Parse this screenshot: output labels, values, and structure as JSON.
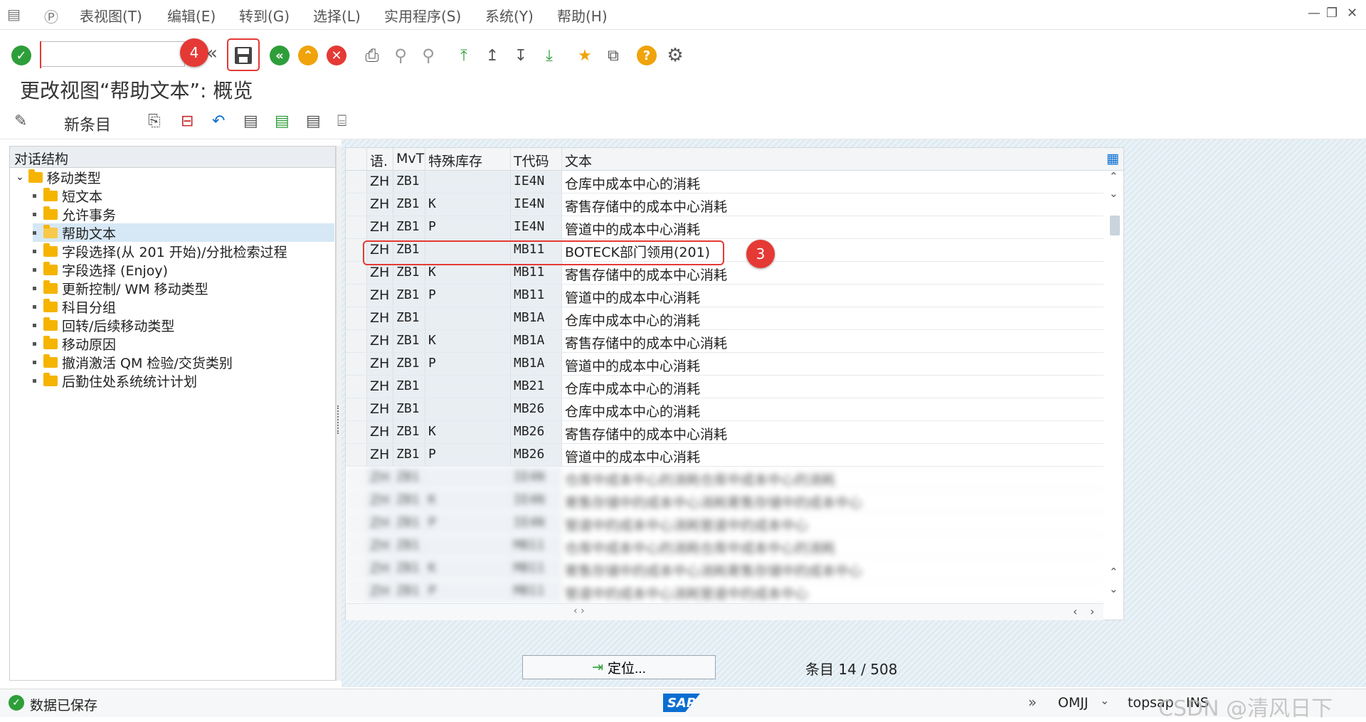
{
  "menu": {
    "items": [
      "表视图(T)",
      "编辑(E)",
      "转到(G)",
      "选择(L)",
      "实用程序(S)",
      "系统(Y)",
      "帮助(H)"
    ],
    "window_controls": [
      "—",
      "❐",
      "✕"
    ]
  },
  "toolbar": {
    "command_field_value": "",
    "markers": {
      "save": "4",
      "row": "3"
    }
  },
  "page": {
    "title": "更改视图“帮助文本”: 概览"
  },
  "app_toolbar": {
    "new_entries": "新条目"
  },
  "tree": {
    "header": "对话结构",
    "root": "移动类型",
    "items": [
      "短文本",
      "允许事务",
      "帮助文本",
      "字段选择(从 201 开始)/分批检索过程",
      "字段选择 (Enjoy)",
      "更新控制/ WM 移动类型",
      "科目分组",
      "回转/后续移动类型",
      "移动原因",
      "撤消激活 QM 检验/交货类别",
      "后勤住处系统统计计划"
    ],
    "selected": "帮助文本"
  },
  "table": {
    "columns": [
      "语.",
      "MvT",
      "特殊库存",
      "T代码",
      "文本"
    ],
    "rows": [
      [
        "ZH",
        "ZB1",
        "",
        "IE4N",
        "仓库中成本中心的消耗"
      ],
      [
        "ZH",
        "ZB1",
        "K",
        "IE4N",
        "寄售存储中的成本中心消耗"
      ],
      [
        "ZH",
        "ZB1",
        "P",
        "IE4N",
        "管道中的成本中心消耗"
      ],
      [
        "ZH",
        "ZB1",
        "",
        "MB11",
        "BOTECK部门领用(201)"
      ],
      [
        "ZH",
        "ZB1",
        "K",
        "MB11",
        "寄售存储中的成本中心消耗"
      ],
      [
        "ZH",
        "ZB1",
        "P",
        "MB11",
        "管道中的成本中心消耗"
      ],
      [
        "ZH",
        "ZB1",
        "",
        "MB1A",
        "仓库中成本中心的消耗"
      ],
      [
        "ZH",
        "ZB1",
        "K",
        "MB1A",
        "寄售存储中的成本中心消耗"
      ],
      [
        "ZH",
        "ZB1",
        "P",
        "MB1A",
        "管道中的成本中心消耗"
      ],
      [
        "ZH",
        "ZB1",
        "",
        "MB21",
        "仓库中成本中心的消耗"
      ],
      [
        "ZH",
        "ZB1",
        "",
        "MB26",
        "仓库中成本中心的消耗"
      ],
      [
        "ZH",
        "ZB1",
        "K",
        "MB26",
        "寄售存储中的成本中心消耗"
      ],
      [
        "ZH",
        "ZB1",
        "P",
        "MB26",
        "管道中的成本中心消耗"
      ]
    ],
    "blurred_rows": [
      [
        "ZH",
        "ZB1",
        "",
        "IE4N",
        "仓库中成本中心的消耗仓库中成本中心的消耗"
      ],
      [
        "ZH",
        "ZB1",
        "K",
        "IE4N",
        "寄售存储中的成本中心消耗寄售存储中的成本中心"
      ],
      [
        "ZH",
        "ZB1",
        "P",
        "IE4N",
        "管道中的成本中心消耗管道中的成本中心"
      ],
      [
        "ZH",
        "ZB1",
        "",
        "MB11",
        "仓库中成本中心的消耗仓库中成本中心的消耗"
      ],
      [
        "ZH",
        "ZB1",
        "K",
        "MB11",
        "寄售存储中的成本中心消耗寄售存储中的成本中心"
      ],
      [
        "ZH",
        "ZB1",
        "P",
        "MB11",
        "管道中的成本中心消耗管道中的成本中心"
      ]
    ],
    "highlighted_row": 3
  },
  "footer": {
    "position_button": "定位...",
    "entries_label": "条目",
    "entries_value": "14 / 508"
  },
  "status": {
    "message": "数据已保存",
    "logo": "SAP",
    "transaction": "OMJJ",
    "server": "topsap",
    "mode": "INS",
    "watermark": "CSDN @清风日下"
  },
  "colors": {
    "green": "#2e9e3a",
    "orange": "#f0a30a",
    "red": "#e53935",
    "highlight": "#e53935",
    "sap_blue": "#0a6ed1"
  }
}
